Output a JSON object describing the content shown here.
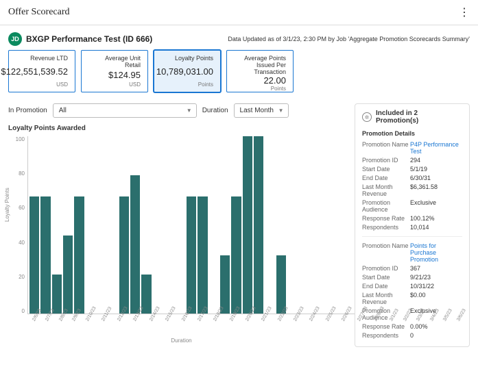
{
  "header": {
    "title": "Offer Scorecard"
  },
  "entity": {
    "badge": "JD",
    "name": "BXGP Performance Test",
    "id_label": "(ID 666)",
    "timestamp": "Data Updated as of 3/1/23, 2:30 PM by Job 'Aggregate Promotion Scorecards Summary'"
  },
  "cards": [
    {
      "label": "Revenue LTD",
      "value": "$122,551,539.52",
      "unit": "USD"
    },
    {
      "label": "Average Unit Retail",
      "value": "$124.95",
      "unit": "USD"
    },
    {
      "label": "Loyalty Points",
      "value": "10,789,031.00",
      "unit": "Points",
      "selected": true
    },
    {
      "label": "Average Points Issued Per Transaction",
      "value": "22.00",
      "unit": "Points"
    }
  ],
  "filters": {
    "in_promotion_label": "In Promotion",
    "in_promotion_value": "All",
    "duration_label": "Duration",
    "duration_value": "Last Month"
  },
  "chart_data": {
    "type": "bar",
    "title": "Loyalty Points Awarded",
    "ylabel": "Loyalty Points",
    "xlabel": "Duration",
    "ylim": [
      0,
      100
    ],
    "yticks": [
      0,
      20,
      40,
      60,
      80,
      100
    ],
    "categories": [
      "2/6/23",
      "2/7/23",
      "2/8/23",
      "2/9/23",
      "2/10/23",
      "2/11/23",
      "2/12/23",
      "2/13/23",
      "2/14/23",
      "2/15/23",
      "2/16/23",
      "2/17/23",
      "2/18/23",
      "2/19/23",
      "2/20/23",
      "2/21/23",
      "2/22/23",
      "2/23/23",
      "2/24/23",
      "2/25/23",
      "2/26/23",
      "2/27/23",
      "2/28/23",
      "3/1/23",
      "3/2/23",
      "3/3/23",
      "3/4/23",
      "3/5/23",
      "3/6/23"
    ],
    "values": [
      66,
      66,
      22,
      44,
      66,
      0,
      0,
      0,
      66,
      78,
      22,
      0,
      0,
      0,
      66,
      66,
      0,
      33,
      66,
      100,
      100,
      0,
      33,
      0,
      0,
      0,
      0,
      0,
      0
    ]
  },
  "side": {
    "heading_prefix": "Included in ",
    "heading_count": "2",
    "heading_suffix": " Promotion(s)",
    "subheading": "Promotion Details",
    "promotions": [
      {
        "name": "P4P Performance Test",
        "id": "294",
        "start_date": "5/1/19",
        "end_date": "6/30/31",
        "last_month_revenue": "$6,361.58",
        "audience": "Exclusive",
        "response_rate": "100.12%",
        "respondents": "10,014"
      },
      {
        "name": "Points for Purchase Promotion",
        "id": "367",
        "start_date": "9/21/23",
        "end_date": "10/31/22",
        "last_month_revenue": "$0.00",
        "audience": "Exclusive",
        "response_rate": "0.00%",
        "respondents": "0"
      }
    ],
    "labels": {
      "name": "Promotion Name",
      "id": "Promotion ID",
      "start_date": "Start Date",
      "end_date": "End Date",
      "last_month_revenue": "Last Month Revenue",
      "audience": "Promotion Audience",
      "response_rate": "Response Rate",
      "respondents": "Respondents"
    }
  }
}
